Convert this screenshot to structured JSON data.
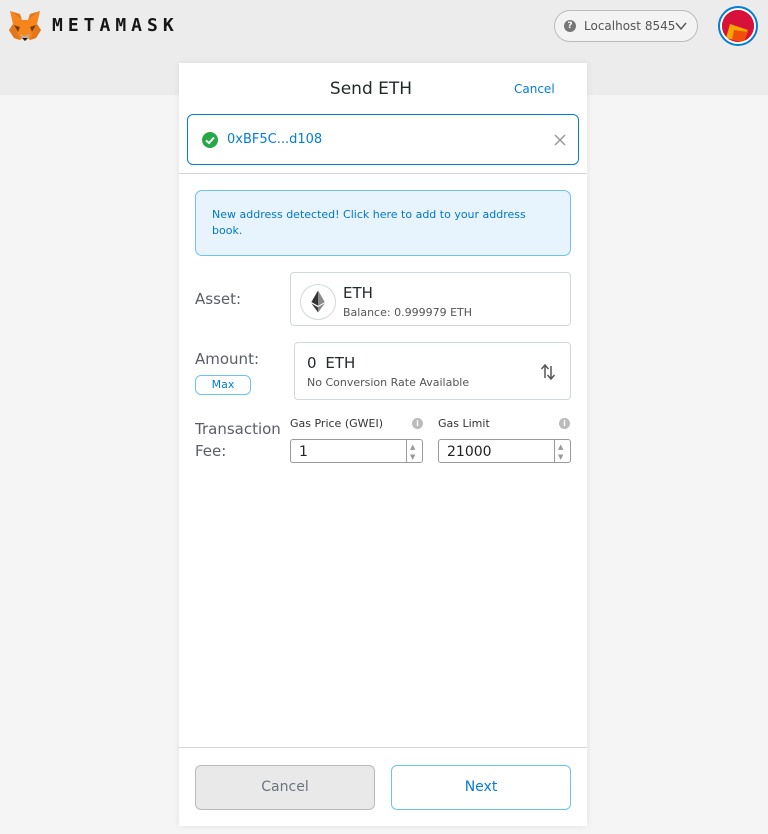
{
  "app": {
    "wordmark": "METAMASK"
  },
  "network": {
    "label": "Localhost 8545",
    "status_icon": "question-circle-icon"
  },
  "header": {
    "title": "Send ETH",
    "cancel_label": "Cancel"
  },
  "recipient": {
    "address": "0xBF5C...d108",
    "status_icon": "check-circle-icon"
  },
  "notice": {
    "text": "New address detected! Click here to add to your address book."
  },
  "asset": {
    "label": "Asset:",
    "name": "ETH",
    "balance_label": "Balance:",
    "balance_value": "0.999979",
    "balance_unit": "ETH"
  },
  "amount": {
    "label": "Amount:",
    "max_label": "Max",
    "value": "0",
    "unit": "ETH",
    "conversion": "No Conversion Rate Available"
  },
  "fee": {
    "label_line1": "Transaction",
    "label_line2": "Fee:",
    "gas_price_label": "Gas Price (GWEI)",
    "gas_price_value": "1",
    "gas_limit_label": "Gas Limit",
    "gas_limit_value": "21000"
  },
  "footer": {
    "cancel_label": "Cancel",
    "next_label": "Next"
  },
  "colors": {
    "accent": "#037dd6",
    "success": "#28a745",
    "notice_bg": "#e8f4fd"
  }
}
